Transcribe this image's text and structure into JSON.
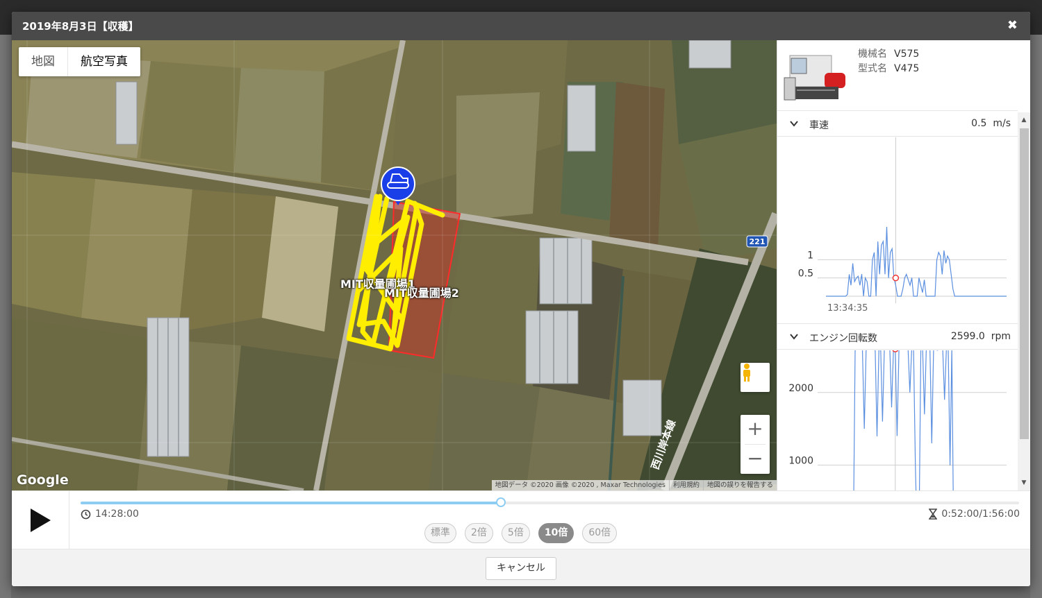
{
  "modal": {
    "title": "2019年8月3日【収穫】",
    "close_icon": "close-icon"
  },
  "map": {
    "type_buttons": [
      "地図",
      "航空写真"
    ],
    "active_type": "航空写真",
    "field_labels": [
      "MIT収量圃場1",
      "MIT収量圃場2"
    ],
    "route_badge": "221",
    "zoom_in": "+",
    "zoom_out": "−",
    "logo": "Google",
    "attribution": "地図データ ©2020 画像 ©2020 , Maxar Technologies",
    "terms_link": "利用規約",
    "report_link": "地図の誤りを報告する",
    "road_label": "西川岸本線",
    "colors": {
      "track": "#ffee00",
      "field": "#c0392b",
      "marker": "#1a3ee8"
    }
  },
  "machine": {
    "name_label": "機械名",
    "name_value": "V575",
    "model_label": "型式名",
    "model_value": "V475"
  },
  "sections": [
    {
      "title": "車速",
      "value": "0.5",
      "unit": "m/s"
    },
    {
      "title": "エンジン回転数",
      "value": "2599.0",
      "unit": "rpm"
    }
  ],
  "chart_data": [
    {
      "type": "line",
      "title": "車速",
      "y_ticks": [
        "1",
        "0.5"
      ],
      "ylim": [
        0,
        1.9
      ],
      "x_tick": "13:34:35",
      "cursor_value": 0.5,
      "series_color": "#5b8fe0",
      "values": [
        0,
        0,
        0,
        0,
        0,
        0,
        0,
        0,
        0,
        0,
        0,
        0,
        0.05,
        0.6,
        0.3,
        0.9,
        0.4,
        0.5,
        0.55,
        0.3,
        0.6,
        0.0,
        0.5,
        0.4,
        0.0,
        0.0,
        1.0,
        1.2,
        0.0,
        1.5,
        0.6,
        1.4,
        1.5,
        0.6,
        1.9,
        0.5,
        1.2,
        1.3,
        0.5,
        0.3,
        0.0,
        0.0,
        0.0,
        0.2,
        0.5,
        0.6,
        0.45,
        0.3,
        0.5,
        0.0,
        0.0,
        0.0,
        0.5,
        0.3,
        0.1,
        0.45,
        0.0,
        0.0,
        0.0,
        0.0,
        0.0,
        0.0,
        1.0,
        1.2,
        1.1,
        0.6,
        1.25,
        0.9,
        1.1,
        1.0,
        0.6,
        0.2,
        0.0,
        0.0,
        0.0,
        0.0,
        0.0,
        0.0,
        0.0,
        0.0,
        0.0,
        0.0,
        0.0,
        0.0,
        0.0,
        0.0,
        0.0,
        0.0,
        0.0,
        0.0,
        0.0,
        0.0,
        0.0,
        0.0,
        0.0,
        0.0,
        0.0,
        0.0,
        0.0,
        0.0,
        0.0,
        0.0
      ]
    },
    {
      "type": "line",
      "title": "エンジン回転数",
      "y_ticks": [
        "2000",
        "1000"
      ],
      "ylim": [
        0,
        2600
      ],
      "cursor_value": 2599.0,
      "series_color": "#5b8fe0",
      "values": [
        0,
        0,
        0,
        0,
        0,
        0,
        0,
        0,
        0,
        0,
        0,
        0,
        0,
        0,
        0,
        0,
        2580,
        2590,
        2600,
        2590,
        2595,
        1500,
        2580,
        2590,
        2590,
        2600,
        2590,
        2580,
        1400,
        2580,
        2590,
        1600,
        2590,
        2600,
        2590,
        2610,
        1800,
        2590,
        2595,
        1400,
        2600,
        2590,
        2600,
        2595,
        2600,
        2600,
        2000,
        2590,
        2600,
        1000,
        0,
        0,
        2600,
        2590,
        1700,
        2595,
        2590,
        2600,
        1300,
        2590,
        2600,
        2580,
        2590,
        2600,
        2600,
        1900,
        2590,
        2595,
        1000,
        2600,
        0,
        0,
        0,
        0,
        0,
        0,
        0,
        0,
        0,
        0,
        0,
        0,
        0,
        0,
        0,
        0,
        0,
        0,
        0,
        0,
        0,
        0,
        0,
        0,
        0,
        0,
        0,
        0,
        0,
        0
      ]
    }
  ],
  "player": {
    "current_time": "14:28:00",
    "elapsed_total": "0:52:00/1:56:00",
    "progress": 0.448,
    "speeds": [
      "標準",
      "2倍",
      "5倍",
      "10倍",
      "60倍"
    ],
    "active_speed": "10倍"
  },
  "footer": {
    "cancel_label": "キャンセル"
  }
}
